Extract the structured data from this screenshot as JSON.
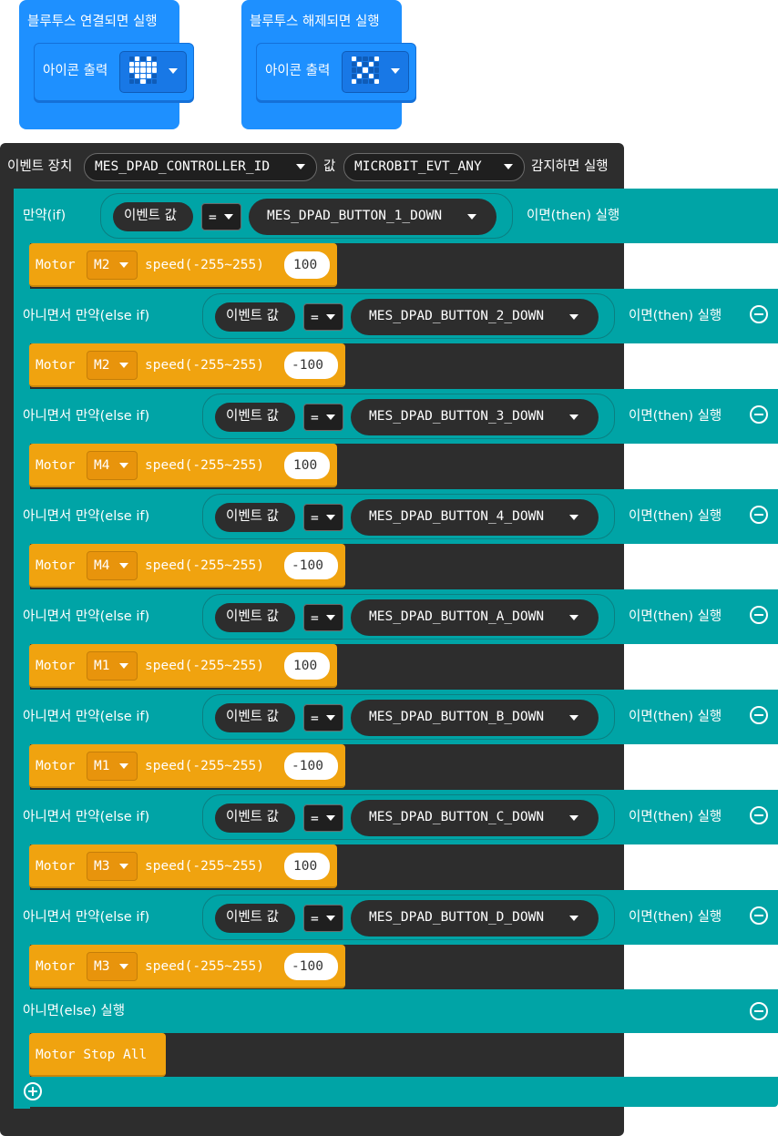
{
  "bluetooth": {
    "connected": {
      "hat_label": "블루투스 연결되면 실행",
      "inner_label": "아이콘 출력",
      "icon": "heart-led-icon",
      "leds": [
        [
          0,
          1,
          0,
          1,
          0
        ],
        [
          1,
          1,
          1,
          1,
          1
        ],
        [
          1,
          1,
          1,
          1,
          1
        ],
        [
          0,
          1,
          1,
          1,
          0
        ],
        [
          0,
          0,
          1,
          0,
          0
        ]
      ]
    },
    "disconnected": {
      "hat_label": "블루투스 해제되면 실행",
      "inner_label": "아이콘 출력",
      "icon": "x-led-icon",
      "leds": [
        [
          1,
          0,
          0,
          0,
          1
        ],
        [
          0,
          1,
          0,
          1,
          0
        ],
        [
          0,
          0,
          1,
          0,
          0
        ],
        [
          0,
          1,
          0,
          1,
          0
        ],
        [
          1,
          0,
          0,
          0,
          1
        ]
      ]
    }
  },
  "event": {
    "prefix": "이벤트 장치",
    "device": "MES_DPAD_CONTROLLER_ID",
    "value_label": "값",
    "event_value": "MICROBIT_EVT_ANY",
    "suffix": "감지하면 실행"
  },
  "condition_common": {
    "event_value_label": "이벤트 값",
    "operator": "=",
    "then_label": "이면(then) 실행"
  },
  "branches": [
    {
      "label": "만약(if)",
      "button": "MES_DPAD_BUTTON_1_DOWN",
      "motor_label": "Motor",
      "motor": "M2",
      "speed_label": "speed(-255~255)",
      "speed": "100"
    },
    {
      "label": "아니면서 만약(else if)",
      "button": "MES_DPAD_BUTTON_2_DOWN",
      "motor_label": "Motor",
      "motor": "M2",
      "speed_label": "speed(-255~255)",
      "speed": "-100"
    },
    {
      "label": "아니면서 만약(else if)",
      "button": "MES_DPAD_BUTTON_3_DOWN",
      "motor_label": "Motor",
      "motor": "M4",
      "speed_label": "speed(-255~255)",
      "speed": "100"
    },
    {
      "label": "아니면서 만약(else if)",
      "button": "MES_DPAD_BUTTON_4_DOWN",
      "motor_label": "Motor",
      "motor": "M4",
      "speed_label": "speed(-255~255)",
      "speed": "-100"
    },
    {
      "label": "아니면서 만약(else if)",
      "button": "MES_DPAD_BUTTON_A_DOWN",
      "motor_label": "Motor",
      "motor": "M1",
      "speed_label": "speed(-255~255)",
      "speed": "100"
    },
    {
      "label": "아니면서 만약(else if)",
      "button": "MES_DPAD_BUTTON_B_DOWN",
      "motor_label": "Motor",
      "motor": "M1",
      "speed_label": "speed(-255~255)",
      "speed": "-100"
    },
    {
      "label": "아니면서 만약(else if)",
      "button": "MES_DPAD_BUTTON_C_DOWN",
      "motor_label": "Motor",
      "motor": "M3",
      "speed_label": "speed(-255~255)",
      "speed": "100"
    },
    {
      "label": "아니면서 만약(else if)",
      "button": "MES_DPAD_BUTTON_D_DOWN",
      "motor_label": "Motor",
      "motor": "M3",
      "speed_label": "speed(-255~255)",
      "speed": "-100"
    }
  ],
  "else_branch": {
    "label": "아니면(else) 실행",
    "action": "Motor Stop All"
  },
  "colors": {
    "bluetooth": "#1e90ff",
    "event": "#2d2d2d",
    "logic": "#00a4a6",
    "motor": "#f0a30f"
  }
}
